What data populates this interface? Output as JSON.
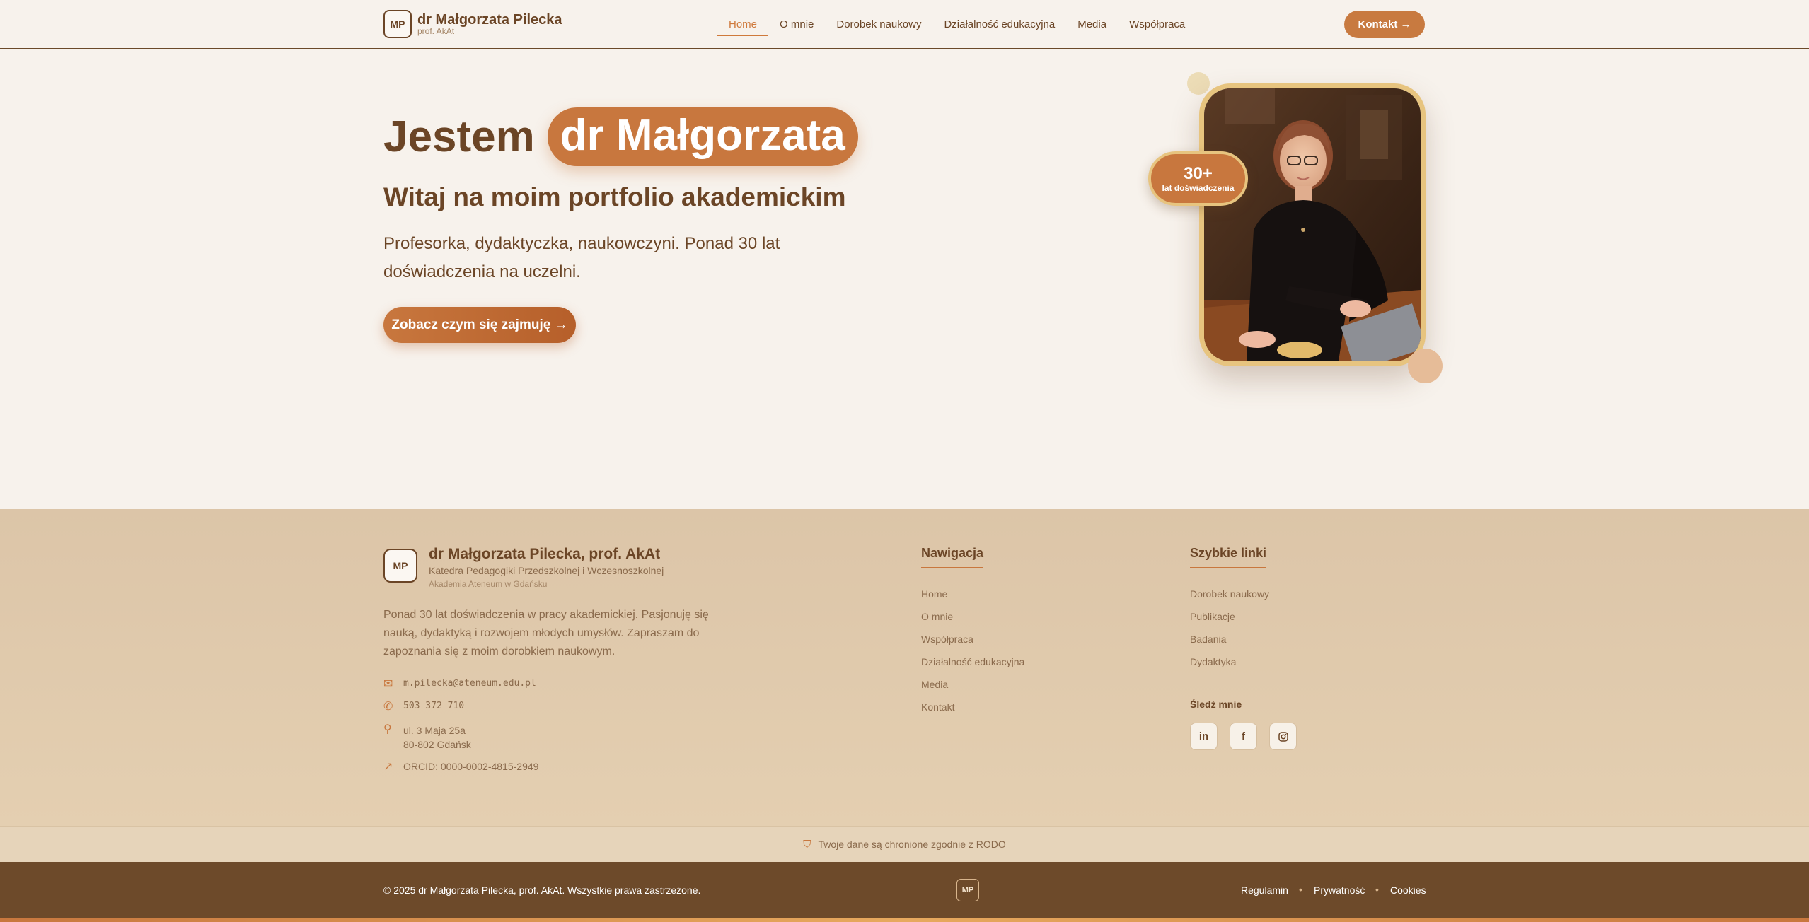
{
  "header": {
    "logo_initials": "MP",
    "brand_name": "dr Małgorzata Pilecka",
    "brand_sub": "prof. AkAt",
    "nav": [
      "Home",
      "O mnie",
      "Dorobek naukowy",
      "Działalność edukacyjna",
      "Media",
      "Współpraca"
    ],
    "active_nav": "Home",
    "contact_button": "Kontakt →"
  },
  "hero": {
    "title_prefix": "Jestem",
    "title_highlight": "dr Małgorzata",
    "subtitle": "Witaj na moim portfolio akademickim",
    "description": "Profesorka, dydaktyczka, naukowczyni. Ponad 30 lat doświadczenia na uczelni.",
    "cta": "Zobacz czym się zajmuję →",
    "badge_number": "30+",
    "badge_label": "lat doświadczenia"
  },
  "footer": {
    "logo_initials": "MP",
    "name": "dr Małgorzata Pilecka, prof. AkAt",
    "department": "Katedra Pedagogiki Przedszkolnej i Wczesnoszkolnej",
    "academy": "Akademia Ateneum w Gdańsku",
    "description": "Ponad 30 lat doświadczenia w pracy akademickiej. Pasjonuję się nauką, dydaktyką i rozwojem młodych umysłów. Zapraszam do zapoznania się z moim dorobkiem naukowym.",
    "email": "m.pilecka@ateneum.edu.pl",
    "phone": "503 372 710",
    "address_line1": "ul. 3 Maja 25a",
    "address_line2": "80-802 Gdańsk",
    "orcid": "ORCID: 0000-0002-4815-2949",
    "nav_title": "Nawigacja",
    "nav_links": [
      "Home",
      "O mnie",
      "Współpraca",
      "Działalność edukacyjna",
      "Media",
      "Kontakt"
    ],
    "quick_title": "Szybkie linki",
    "quick_links": [
      "Dorobek naukowy",
      "Publikacje",
      "Badania",
      "Dydaktyka"
    ],
    "follow_title": "Śledź mnie",
    "social_icons": [
      "linkedin-icon",
      "facebook-icon",
      "instagram-icon"
    ],
    "rodo": "Twoje dane są chronione zgodnie z RODO",
    "copyright": "© 2025 dr Małgorzata Pilecka, prof. AkAt. Wszystkie prawa zastrzeżone.",
    "bottom_logo": "MP",
    "legal_links": [
      "Regulamin",
      "Prywatność",
      "Cookies"
    ]
  },
  "colors": {
    "accent": "#c8773e",
    "brown": "#6b4526",
    "gold": "#e7c47f",
    "background": "#f7f2ec",
    "footer_bg": "#dcc5a8",
    "bottom_bar": "#6d4a2a"
  }
}
